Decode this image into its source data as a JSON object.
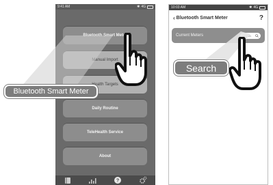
{
  "phone1": {
    "status_time": "9:41 AM",
    "status_network": "4G",
    "menu": [
      {
        "label": "Bluetooth Smart Meter",
        "active": true
      },
      {
        "label": "Manual Import",
        "active": false
      },
      {
        "label": "Health Targets",
        "active": false
      },
      {
        "label": "Daily Routine",
        "active": true
      },
      {
        "label": "TeleHealth Service",
        "active": true
      },
      {
        "label": "About",
        "active": true
      }
    ],
    "tabs": [
      "logbook-icon",
      "chart-icon",
      "help-icon",
      "settings-icon"
    ]
  },
  "phone2": {
    "status_time": "10:03 AM",
    "status_network": "4G",
    "back_glyph": "‹",
    "nav_title": "Bluetooth Smart Meter",
    "help_glyph": "?",
    "row_label": "Current Meters",
    "search_placeholder": "Search"
  },
  "callouts": {
    "left": "Bluetooth Smart Meter",
    "right": "Search"
  },
  "colors": {
    "phone_bg": "#6a6a6a",
    "button": "#8d8d8d",
    "callout": "#7d7d7d"
  }
}
